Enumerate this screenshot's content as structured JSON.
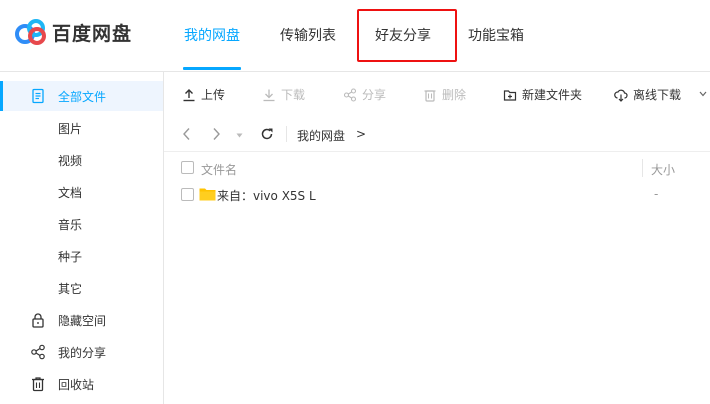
{
  "app": {
    "name": "百度网盘"
  },
  "nav": {
    "tabs": [
      {
        "label": "我的网盘",
        "active": true
      },
      {
        "label": "传输列表",
        "active": false
      },
      {
        "label": "好友分享",
        "active": false,
        "highlighted": true
      },
      {
        "label": "功能宝箱",
        "active": false
      }
    ]
  },
  "sidebar": {
    "items": [
      {
        "label": "全部文件",
        "icon": "document-icon",
        "active": true
      },
      {
        "label": "图片"
      },
      {
        "label": "视频"
      },
      {
        "label": "文档"
      },
      {
        "label": "音乐"
      },
      {
        "label": "种子"
      },
      {
        "label": "其它"
      },
      {
        "label": "隐藏空间",
        "icon": "lock-icon"
      },
      {
        "label": "我的分享",
        "icon": "share-icon"
      },
      {
        "label": "回收站",
        "icon": "trash-icon"
      }
    ]
  },
  "toolbar": {
    "upload": "上传",
    "download": "下载",
    "share": "分享",
    "delete": "删除",
    "new_folder": "新建文件夹",
    "offline_download": "离线下载"
  },
  "breadcrumb": {
    "path": "我的网盘",
    "arrow": ">"
  },
  "table": {
    "headers": {
      "name": "文件名",
      "size": "大小"
    },
    "rows": [
      {
        "name": "来自：vivo X5S L",
        "size": "-",
        "type": "folder"
      }
    ]
  },
  "colors": {
    "accent": "#06a7ff",
    "highlight": "#ee1111",
    "folder": "#ffc300"
  }
}
